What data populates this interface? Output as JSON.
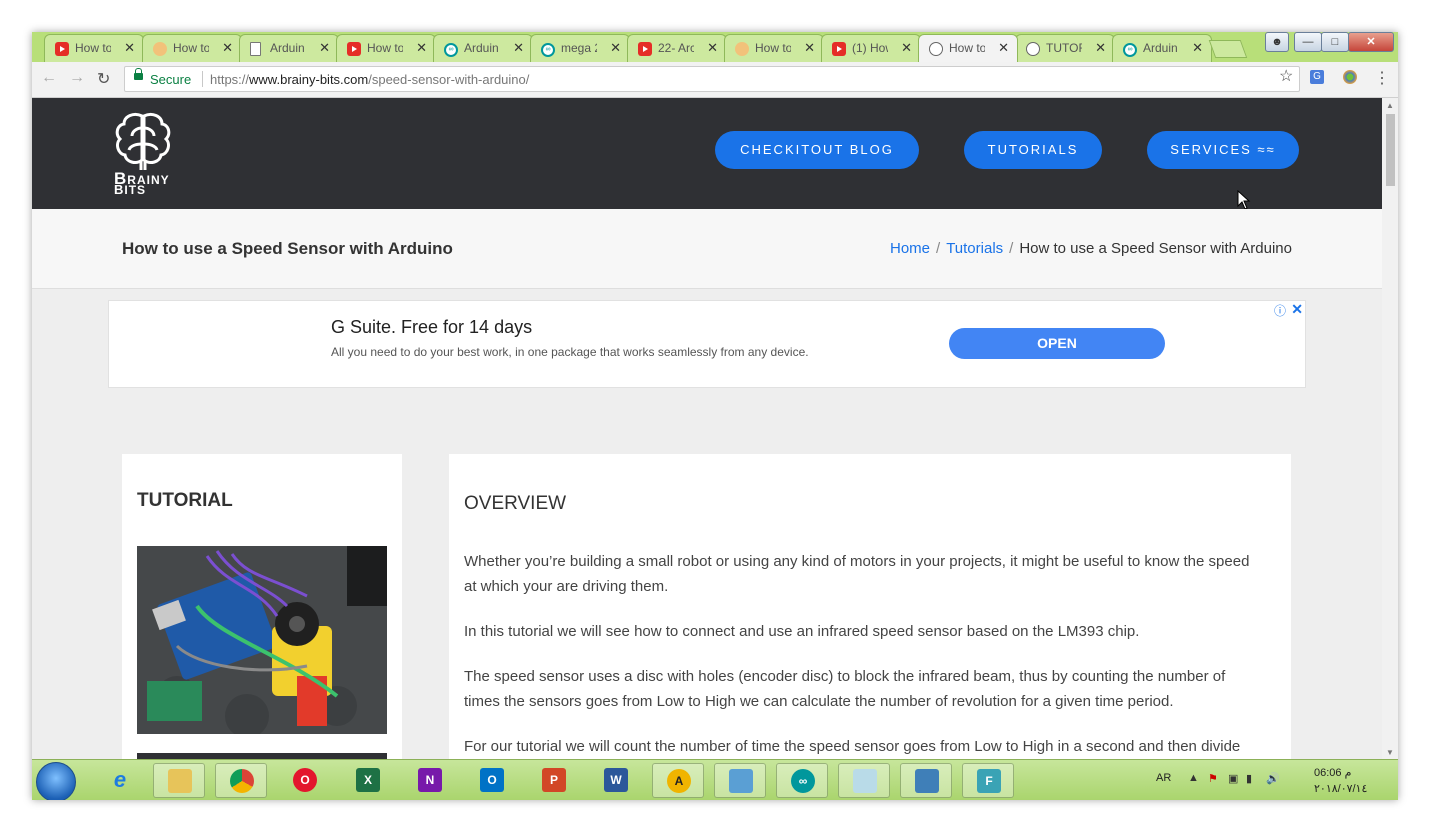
{
  "browser": {
    "tabs": [
      {
        "title": "How to",
        "icon": "youtube-icon",
        "active": false
      },
      {
        "title": "How to",
        "icon": "avatar-icon",
        "active": false
      },
      {
        "title": "Arduin",
        "icon": "document-icon",
        "active": false
      },
      {
        "title": "How to",
        "icon": "youtube-icon",
        "active": false
      },
      {
        "title": "Arduin",
        "icon": "arduino-icon",
        "active": false
      },
      {
        "title": "mega 2",
        "icon": "arduino-icon",
        "active": false
      },
      {
        "title": "22- Arc",
        "icon": "youtube-icon",
        "active": false
      },
      {
        "title": "How to",
        "icon": "avatar-icon",
        "active": false
      },
      {
        "title": "(1) How",
        "icon": "youtube-icon",
        "active": false
      },
      {
        "title": "How to",
        "icon": "brain-icon",
        "active": true
      },
      {
        "title": "TUTOR",
        "icon": "brain-icon",
        "active": false
      },
      {
        "title": "Arduin",
        "icon": "arduino-icon",
        "active": false
      }
    ],
    "secure_label": "Secure",
    "url_scheme": "https://",
    "url_host": "www.brainy-bits.com",
    "url_path": "/speed-sensor-with-arduino/"
  },
  "site": {
    "logo_text_1": "RAINY",
    "logo_text_2": "ITS",
    "nav": [
      {
        "label": "CHECKITOUT BLOG"
      },
      {
        "label": "TUTORIALS"
      },
      {
        "label": "SERVICES ≈≈"
      }
    ],
    "page_title": "How to use a Speed Sensor with Arduino",
    "breadcrumb": {
      "home": "Home",
      "tutorials": "Tutorials",
      "current": "How to use a Speed Sensor with Arduino"
    }
  },
  "ad": {
    "headline": "G Suite. Free for 14 days",
    "description": "All you need to do your best work, in one package that works seamlessly from any device.",
    "cta": "OPEN"
  },
  "sidebar": {
    "heading": "TUTORIAL"
  },
  "article": {
    "heading": "OVERVIEW",
    "paragraphs": [
      "Whether you’re building a small robot or using any kind of motors in your projects, it might be useful to know the speed at which your are driving them.",
      "In this tutorial we will see how to connect and use an infrared speed sensor based on the LM393 chip.",
      "The speed sensor uses a disc with holes (encoder disc) to block the infrared beam, thus by counting the number of times the sensors goes from Low to High we can calculate the number of revolution for a given time period.",
      "For our tutorial we will count the number of time the speed sensor goes from Low to High in a second and then divide"
    ]
  },
  "taskbar": {
    "apps": [
      "Internet Explorer",
      "File Explorer",
      "Google Chrome",
      "Opera",
      "Excel",
      "OneNote",
      "Outlook",
      "PowerPoint",
      "Word",
      "Archicad",
      "Control Panel",
      "Arduino",
      "Notepad",
      "Photos",
      "Fritzing"
    ],
    "lang": "AR",
    "time": "06:06 م",
    "date": "٢٠١٨/٠٧/١٤"
  },
  "colors": {
    "accent": "#1a73e8",
    "header_bg": "#2f3034",
    "chrome_frame": "#b8df79"
  }
}
